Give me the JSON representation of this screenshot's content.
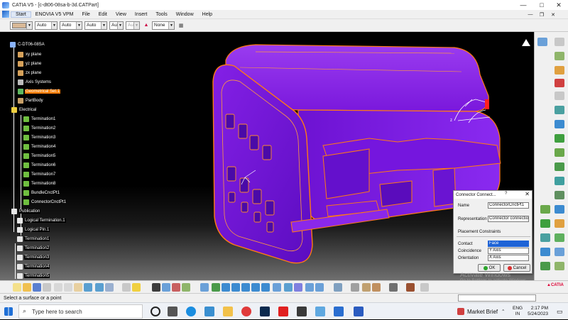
{
  "window": {
    "title": "CATIA V5 - [c-dt06-08sa-b-3d.CATPart]",
    "minimize": "—",
    "maximize": "□",
    "close": "✕"
  },
  "menu": {
    "items": [
      "Start",
      "ENOVIA V5 VPM",
      "File",
      "Edit",
      "View",
      "Insert",
      "Tools",
      "Window",
      "Help"
    ],
    "active": "Start"
  },
  "format_toolbar": {
    "combos": [
      "Auto",
      "Auto",
      "Auto",
      "Aut",
      "Aut",
      "None"
    ]
  },
  "tree": {
    "root": "C-DT06-08SA",
    "items": [
      {
        "label": "xy plane"
      },
      {
        "label": "yz plane"
      },
      {
        "label": "zx plane"
      },
      {
        "label": "Axis Systems"
      },
      {
        "label": "Geometrical Set.1"
      },
      {
        "label": "PartBody"
      },
      {
        "label": "Electrical"
      },
      {
        "label": "Termination1"
      },
      {
        "label": "Termination2"
      },
      {
        "label": "Termination3"
      },
      {
        "label": "Termination4"
      },
      {
        "label": "Termination5"
      },
      {
        "label": "Termination6"
      },
      {
        "label": "Termination7"
      },
      {
        "label": "Termination8"
      },
      {
        "label": "BundleCnctPt1"
      },
      {
        "label": "ConnectorCnctPt1"
      },
      {
        "label": "Publication"
      },
      {
        "label": "Logical Termination.1"
      },
      {
        "label": "Logical Pin.1"
      },
      {
        "label": "Termination1"
      },
      {
        "label": "Termination2"
      },
      {
        "label": "Termination3"
      },
      {
        "label": "Termination4"
      },
      {
        "label": "Termination5"
      }
    ]
  },
  "dialog": {
    "title": "Connector Connect...",
    "help": "?",
    "close": "✕",
    "name_label": "Name",
    "name_value": "ConnectorCnctPt1",
    "representation_label": "Representation",
    "representation_value": "Connector connectio",
    "placement_label": "Placement Constraints",
    "contact_label": "Contact",
    "contact_value": "Face",
    "coincidence_label": "Coincidence",
    "coincidence_value": "Y Axis",
    "orientation_label": "Orientation",
    "orientation_value": "X Axis",
    "ok": "OK",
    "cancel": "Cancel"
  },
  "watermark": {
    "line1": "Activate Windows",
    "line2": "Go to Settings to activate Windows."
  },
  "status": {
    "prompt": "Select a surface or a point"
  },
  "taskbar": {
    "search_placeholder": "Type here to search",
    "weather": "Market Brief",
    "lang1": "ENG",
    "lang2": "IN",
    "time": "2:17 PM",
    "date": "5/24/2023"
  },
  "colors": {
    "model": "#8b1ee6",
    "edges": "#ff7a14",
    "selection": "#ff7a00"
  }
}
